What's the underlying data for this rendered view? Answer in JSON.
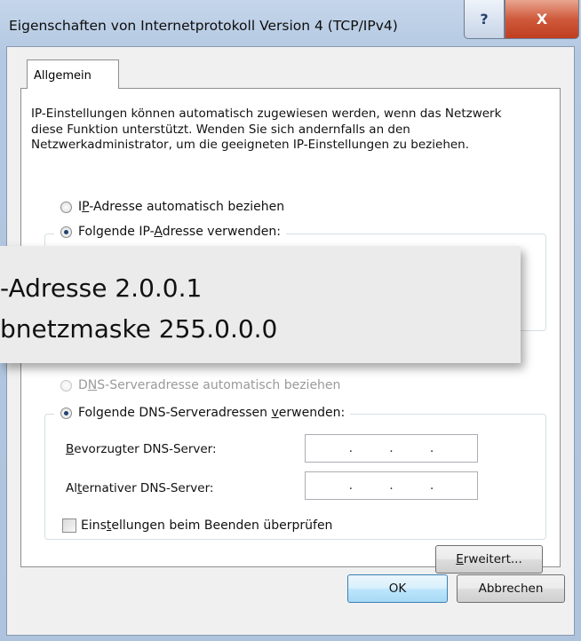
{
  "window": {
    "title": "Eigenschaften von Internetprotokoll Version 4 (TCP/IPv4)",
    "help_glyph": "?",
    "close_glyph": "X"
  },
  "tabs": [
    {
      "label": "Allgemein",
      "selected": true
    }
  ],
  "description": "IP-Einstellungen können automatisch zugewiesen werden, wenn das Netzwerk diese Funktion unterstützt. Wenden Sie sich andernfalls an den Netzwerkadministrator, um die geeigneten IP-Einstellungen zu beziehen.",
  "ip_options": {
    "auto": {
      "pre": "I",
      "key": "P",
      "post": "-Adresse automatisch beziehen",
      "checked": false
    },
    "manual": {
      "pre": "Folgende IP-",
      "key": "A",
      "post": "dresse verwenden:",
      "checked": true
    }
  },
  "dns_options": {
    "auto": {
      "pre": "D",
      "key": "N",
      "post": "S-Serveradresse automatisch beziehen",
      "checked": false,
      "disabled": true
    },
    "manual": {
      "pre": "Folgende DNS-Serveradressen ",
      "key": "v",
      "post": "erwenden:",
      "checked": true
    }
  },
  "dns_fields": [
    {
      "pre": "",
      "key": "B",
      "post": "evorzugter DNS-Server:",
      "dots": [
        ".",
        ".",
        "."
      ]
    },
    {
      "pre": "Al",
      "key": "t",
      "post": "ernativer DNS-Server:",
      "dots": [
        ".",
        ".",
        "."
      ]
    }
  ],
  "validate_checkbox": {
    "pre": "Eins",
    "key": "t",
    "post": "ellungen beim Beenden überprüfen",
    "checked": false
  },
  "buttons": {
    "advanced": {
      "key": "E",
      "post": "rweitert..."
    },
    "ok": "OK",
    "cancel": "Abbrechen"
  },
  "overlay": {
    "line1": "-Adresse 2.0.0.1",
    "line2": "bnetzmaske 255.0.0.0"
  }
}
